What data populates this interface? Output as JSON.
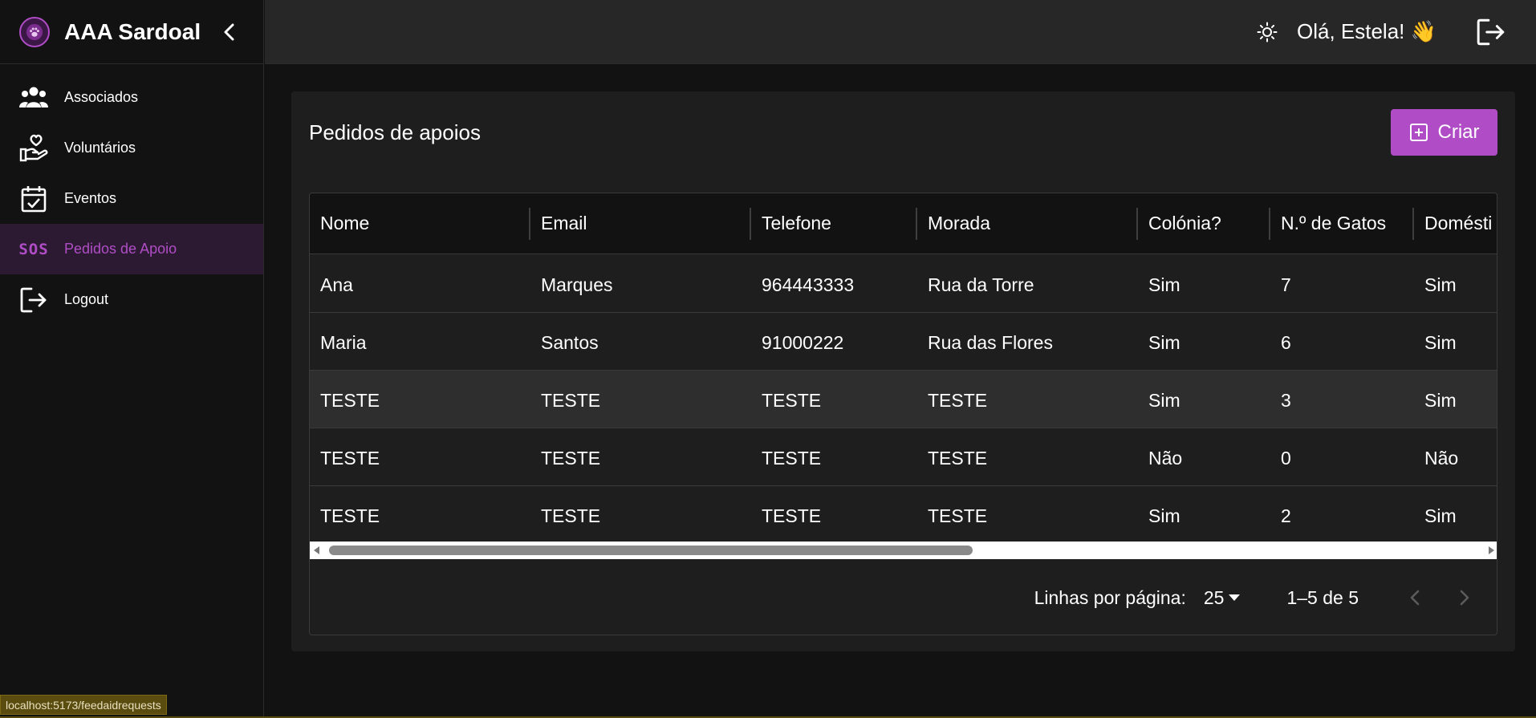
{
  "app": {
    "title": "AAA Sardoal"
  },
  "sidebar": {
    "items": [
      {
        "label": "Associados",
        "icon": "users-icon",
        "active": false
      },
      {
        "label": "Voluntários",
        "icon": "hand-heart-icon",
        "active": false
      },
      {
        "label": "Eventos",
        "icon": "calendar-check-icon",
        "active": false
      },
      {
        "label": "Pedidos de Apoio",
        "icon": "sos-icon",
        "icon_text": "SOS",
        "active": true
      },
      {
        "label": "Logout",
        "icon": "logout-icon",
        "active": false
      }
    ]
  },
  "topbar": {
    "greeting": "Olá, Estela! 👋"
  },
  "page": {
    "title": "Pedidos de apoios",
    "create_label": "Criar"
  },
  "table": {
    "columns": [
      "Nome",
      "Email",
      "Telefone",
      "Morada",
      "Colónia?",
      "N.º de Gatos",
      "Domésti"
    ],
    "rows": [
      [
        "Ana",
        "Marques",
        "964443333",
        "Rua da Torre",
        "Sim",
        "7",
        "Sim"
      ],
      [
        "Maria",
        "Santos",
        "91000222",
        "Rua das Flores",
        "Sim",
        "6",
        "Sim"
      ],
      [
        "TESTE",
        "TESTE",
        "TESTE",
        "TESTE",
        "Sim",
        "3",
        "Sim"
      ],
      [
        "TESTE",
        "TESTE",
        "TESTE",
        "TESTE",
        "Não",
        "0",
        "Não"
      ],
      [
        "TESTE",
        "TESTE",
        "TESTE",
        "TESTE",
        "Sim",
        "2",
        "Sim"
      ]
    ]
  },
  "pagination": {
    "rows_per_page_label": "Linhas por página:",
    "rows_per_page": "25",
    "range": "1–5 de 5"
  },
  "status_bar": {
    "url": "localhost:5173/feedaidrequests"
  },
  "colors": {
    "accent": "#b04dc6",
    "background": "#121212",
    "card": "#1e1e1e"
  }
}
